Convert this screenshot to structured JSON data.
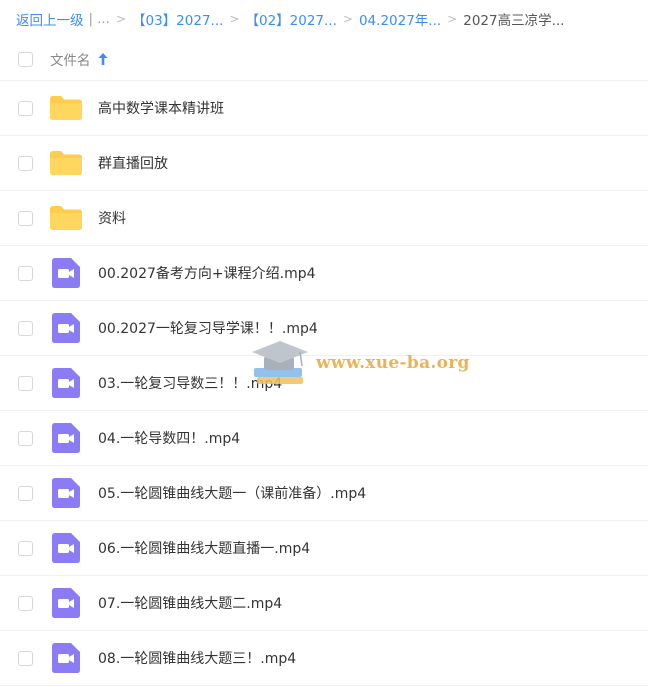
{
  "breadcrumb": {
    "back": "返回上一级",
    "divider": "|",
    "ellipsis": "...",
    "sep": ">",
    "crumbs": [
      "【03】2027...",
      "【02】2027...",
      "04.2027年..."
    ],
    "current": "2027高三凉学..."
  },
  "header": {
    "label": "文件名",
    "sort_icon": "arrow-up-icon"
  },
  "files": [
    {
      "name": "高中数学课本精讲班",
      "type": "folder"
    },
    {
      "name": "群直播回放",
      "type": "folder"
    },
    {
      "name": "资料",
      "type": "folder"
    },
    {
      "name": "00.2027备考方向+课程介绍.mp4",
      "type": "video"
    },
    {
      "name": "00.2027一轮复习导学课！！.mp4",
      "type": "video"
    },
    {
      "name": "03.一轮复习导数三！！.mp4",
      "type": "video"
    },
    {
      "name": "04.一轮导数四！.mp4",
      "type": "video"
    },
    {
      "name": "05.一轮圆锥曲线大题一（课前准备）.mp4",
      "type": "video"
    },
    {
      "name": "06.一轮圆锥曲线大题直播一.mp4",
      "type": "video"
    },
    {
      "name": "07.一轮圆锥曲线大题二.mp4",
      "type": "video"
    },
    {
      "name": "08.一轮圆锥曲线大题三！.mp4",
      "type": "video"
    }
  ],
  "watermark": {
    "text": "www.xue-ba.org"
  },
  "colors": {
    "link": "#3b8cff",
    "folder": "#ffcc4d",
    "video": "#8b7cf6",
    "watermark": "#e8a63a"
  }
}
